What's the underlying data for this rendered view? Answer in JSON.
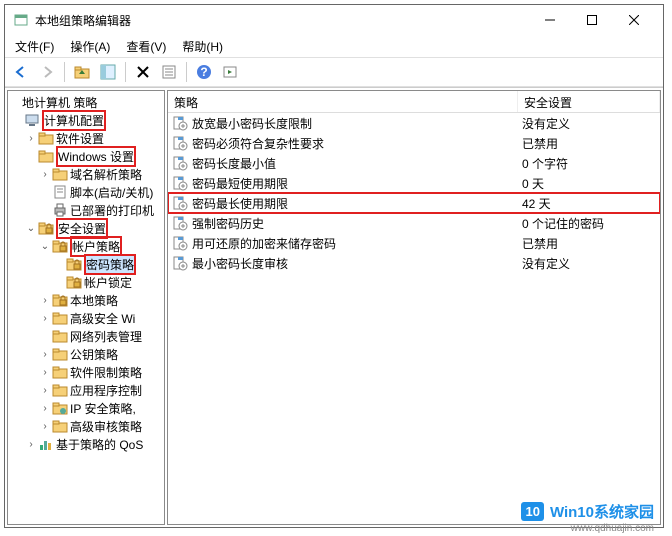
{
  "window": {
    "title": "本地组策略编辑器"
  },
  "menu": {
    "file": "文件(F)",
    "action": "操作(A)",
    "view": "查看(V)",
    "help": "帮助(H)"
  },
  "tree": {
    "root": "地计算机 策略",
    "items": [
      {
        "ind": 0,
        "exp": "",
        "icon": "computer",
        "label": "计算机配置",
        "hl": true
      },
      {
        "ind": 1,
        "exp": "›",
        "icon": "folder",
        "label": "软件设置"
      },
      {
        "ind": 1,
        "exp": "",
        "icon": "folder",
        "label": "Windows 设置",
        "hl": true
      },
      {
        "ind": 2,
        "exp": "›",
        "icon": "folder",
        "label": "域名解析策略"
      },
      {
        "ind": 2,
        "exp": "",
        "icon": "script",
        "label": "脚本(启动/关机)"
      },
      {
        "ind": 2,
        "exp": "",
        "icon": "printer",
        "label": "已部署的打印机"
      },
      {
        "ind": 1,
        "exp": "⌄",
        "icon": "folder-sec",
        "label": "安全设置",
        "hl": true
      },
      {
        "ind": 2,
        "exp": "⌄",
        "icon": "folder-sec",
        "label": "帐户策略",
        "hl": true
      },
      {
        "ind": 3,
        "exp": "",
        "icon": "folder-sec",
        "label": "密码策略",
        "hl": true,
        "sel": true
      },
      {
        "ind": 3,
        "exp": "",
        "icon": "folder-sec",
        "label": "帐户锁定"
      },
      {
        "ind": 2,
        "exp": "›",
        "icon": "folder-sec",
        "label": "本地策略"
      },
      {
        "ind": 2,
        "exp": "›",
        "icon": "folder",
        "label": "高级安全 Wi"
      },
      {
        "ind": 2,
        "exp": "",
        "icon": "folder",
        "label": "网络列表管理"
      },
      {
        "ind": 2,
        "exp": "›",
        "icon": "folder",
        "label": "公钥策略"
      },
      {
        "ind": 2,
        "exp": "›",
        "icon": "folder",
        "label": "软件限制策略"
      },
      {
        "ind": 2,
        "exp": "›",
        "icon": "folder",
        "label": "应用程序控制"
      },
      {
        "ind": 2,
        "exp": "›",
        "icon": "folder-ip",
        "label": "IP 安全策略,"
      },
      {
        "ind": 2,
        "exp": "›",
        "icon": "folder",
        "label": "高级审核策略"
      },
      {
        "ind": 1,
        "exp": "›",
        "icon": "chart",
        "label": "基于策略的 QoS"
      }
    ]
  },
  "list": {
    "headers": {
      "policy": "策略",
      "setting": "安全设置"
    },
    "rows": [
      {
        "policy": "放宽最小密码长度限制",
        "setting": "没有定义"
      },
      {
        "policy": "密码必须符合复杂性要求",
        "setting": "已禁用"
      },
      {
        "policy": "密码长度最小值",
        "setting": "0 个字符"
      },
      {
        "policy": "密码最短使用期限",
        "setting": "0 天"
      },
      {
        "policy": "密码最长使用期限",
        "setting": "42 天",
        "hl": true
      },
      {
        "policy": "强制密码历史",
        "setting": "0 个记住的密码"
      },
      {
        "policy": "用可还原的加密来储存密码",
        "setting": "已禁用"
      },
      {
        "policy": "最小密码长度审核",
        "setting": "没有定义"
      }
    ]
  },
  "watermark": {
    "badge": "10",
    "text": "Win10系统家园",
    "url": "www.qdhuajin.com"
  }
}
